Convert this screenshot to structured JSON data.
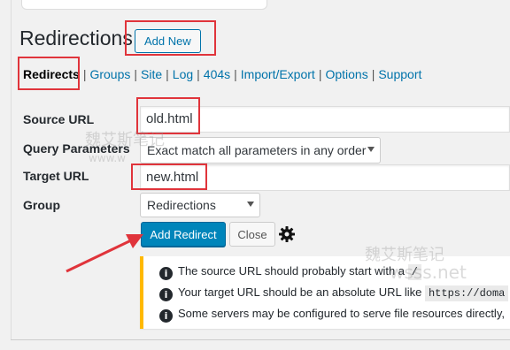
{
  "page": {
    "title": "Redirections",
    "add_new_label": "Add New"
  },
  "subnav": {
    "items": [
      "Redirects",
      "Groups",
      "Site",
      "Log",
      "404s",
      "Import/Export",
      "Options",
      "Support"
    ],
    "separator": "|"
  },
  "form": {
    "source_url": {
      "label": "Source URL",
      "value": "old.html"
    },
    "query_parameters": {
      "label": "Query Parameters",
      "value": "Exact match all parameters in any order"
    },
    "target_url": {
      "label": "Target URL",
      "value": "new.html"
    },
    "group": {
      "label": "Group",
      "value": "Redirections"
    },
    "submit_label": "Add Redirect",
    "close_label": "Close",
    "settings_icon": "gear-icon"
  },
  "notice": {
    "lines": [
      {
        "text": "The source URL should probably start with a",
        "code": "/"
      },
      {
        "text": "Your target URL should be an absolute URL like",
        "code": "https://doma"
      },
      {
        "text": "Some servers may be configured to serve file resources directly,",
        "code": ""
      }
    ],
    "icon": "info-icon",
    "accent_color": "#ffb900"
  },
  "watermark": {
    "cn_text": "魏艾斯笔记",
    "url_text": "www.wsss.net",
    "url_partial_1": "www.w",
    "url_partial_2": "wsss.net"
  },
  "colors": {
    "primary": "#0085ba",
    "link": "#0073aa",
    "highlight": "#e0343b"
  }
}
